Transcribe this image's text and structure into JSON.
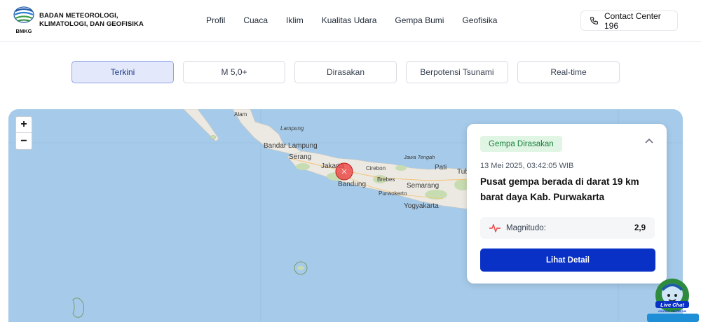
{
  "header": {
    "logo_text": "BMKG",
    "brand_line1": "BADAN METEOROLOGI,",
    "brand_line2": "KLIMATOLOGI, DAN GEOFISIKA",
    "nav": [
      "Profil",
      "Cuaca",
      "Iklim",
      "Kualitas Udara",
      "Gempa Bumi",
      "Geofisika"
    ],
    "contact_label": "Contact Center 196",
    "contact_icon": "phone-icon"
  },
  "tabs": [
    {
      "label": "Terkini",
      "active": true
    },
    {
      "label": "M 5,0+",
      "active": false
    },
    {
      "label": "Dirasakan",
      "active": false
    },
    {
      "label": "Berpotensi Tsunami",
      "active": false
    },
    {
      "label": "Real-time",
      "active": false
    }
  ],
  "map": {
    "zoom_in": "+",
    "zoom_out": "−",
    "labels": {
      "alam": "Alam",
      "lampung": "Lampung",
      "bandar_lampung": "Bandar Lampung",
      "serang": "Serang",
      "jakarta": "Jakarta",
      "cirebon": "Cirebon",
      "jawa_tengah": "Jawa Tengah",
      "pati": "Pati",
      "tuban": "Tuba",
      "bandung": "Bandung",
      "brebes": "Brebes",
      "semarang": "Semarang",
      "purwokerto": "Purwokerto",
      "yogyakarta": "Yogyakarta"
    },
    "colors": {
      "sea": "#a6cbea",
      "land": "#ece9e2",
      "epicenter": "#ef4444"
    }
  },
  "event_card": {
    "badge": "Gempa Dirasakan",
    "collapse_icon": "chevron-up-icon",
    "datetime": "13 Mei 2025, 03:42:05 WIB",
    "headline": "Pusat gempa berada di darat 19 km barat daya Kab. Purwakarta",
    "magnitude_label": "Magnitudo:",
    "magnitude_value": "2,9",
    "magnitude_icon": "pulse-icon",
    "detail_button": "Lihat Detail",
    "accent": "#0a31c6"
  },
  "livechat": {
    "title": "Live Chat",
    "subtitle": "CONTACT CENTER 196"
  }
}
